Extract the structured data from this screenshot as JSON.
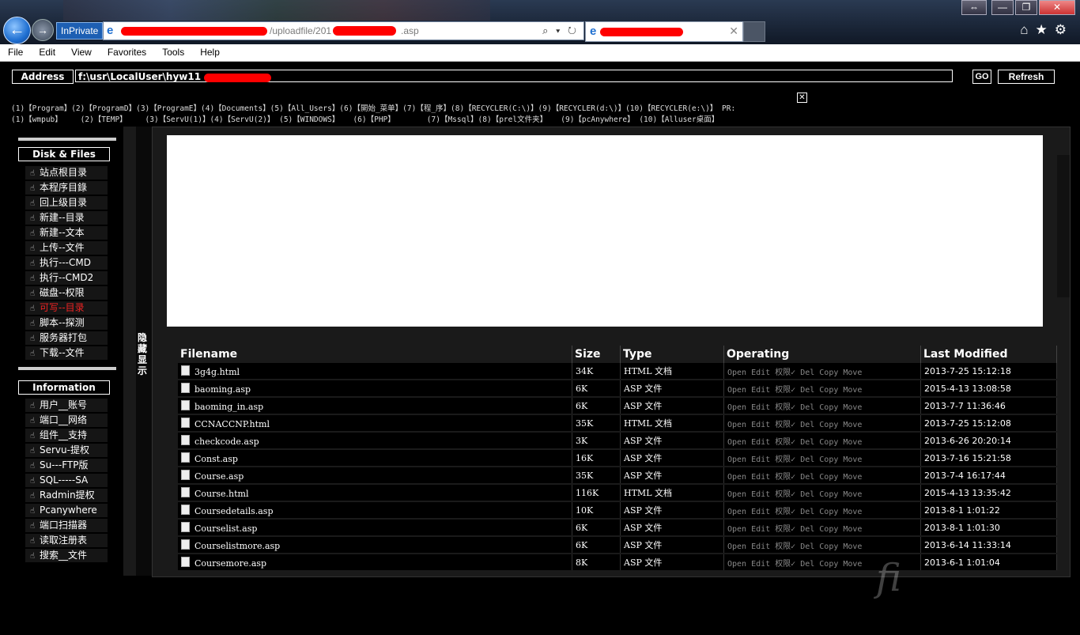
{
  "browser": {
    "inprivate_label": "InPrivate",
    "url_visible": "/uploadfile/201",
    "url_suffix": ".asp",
    "url_controls": "⌕ ▾ ↻",
    "tab_close": "✕",
    "back_icon": "←",
    "forward_icon": "→",
    "window_buttons": [
      "—",
      "❐",
      "✕"
    ],
    "restore_icon": "⇔",
    "toolbar_icons": [
      "home-icon",
      "favorites-star-icon",
      "tools-gear-icon"
    ],
    "toolbar_glyphs": "⌂★⚙"
  },
  "menu": [
    "File",
    "Edit",
    "View",
    "Favorites",
    "Tools",
    "Help"
  ],
  "address": {
    "label": "Address",
    "value": "f:\\usr\\LocalUser\\hyw11",
    "go_label": "GO",
    "refresh_label": "Refresh"
  },
  "quick_links": {
    "row1": "(1)【Program】(2)【ProgramD】(3)【ProgramE】(4)【Documents】(5)【All_Users】(6)【開始_菜单】(7)【程_序】(8)【RECYCLER(C:\\)】(9)【RECYCLER(d:\\)】(10)【RECYCLER(e:\\)】 PR:",
    "row2": "(1)【wmpub】    (2)【TEMP】    (3)【ServU(1)】(4)【ServU(2)】 (5)【WINDOWS】   (6)【PHP】       (7)【Mssql】(8)【prel文件夹】   (9)【pcAnywhere】 (10)【Alluser桌面】",
    "close_icon": "✕"
  },
  "sidebar": {
    "disk_heading": "Disk & Files",
    "disk_items": [
      "站点根目录",
      "本程序目錄",
      "回上级目录",
      "新建--目录",
      "新建--文本",
      "上传--文件",
      "执行---CMD",
      "执行--CMD2",
      "磁盘--权限",
      "可写--目录",
      "脚本--探测",
      "服务器打包",
      "下载--文件"
    ],
    "active_item": "可写--目录",
    "info_heading": "Information",
    "info_items": [
      "用户__账号",
      "端口__网络",
      "组件__支持",
      "Servu-提权",
      "Su---FTP版",
      "SQL-----SA",
      "Radmin提权",
      "Pcanywhere",
      "端口扫描器",
      "读取注册表",
      "搜索__文件"
    ],
    "item_icon": "☝",
    "toggle_label": "隐藏 显示"
  },
  "file_table": {
    "headers": [
      "Filename",
      "Size",
      "Type",
      "Operating",
      "Last Modified"
    ],
    "ops": [
      "Open",
      "Edit",
      "权限✓",
      "Del",
      "Copy",
      "Move"
    ],
    "rows": [
      {
        "name": "3g4g.html",
        "size": "34K",
        "type": "HTML 文档",
        "modified": "2013-7-25 15:12:18"
      },
      {
        "name": "baoming.asp",
        "size": "6K",
        "type": "ASP 文件",
        "modified": "2015-4-13 13:08:58"
      },
      {
        "name": "baoming_in.asp",
        "size": "6K",
        "type": "ASP 文件",
        "modified": "2013-7-7 11:36:46"
      },
      {
        "name": "CCNACCNP.html",
        "size": "35K",
        "type": "HTML 文档",
        "modified": "2013-7-25 15:12:08"
      },
      {
        "name": "checkcode.asp",
        "size": "3K",
        "type": "ASP 文件",
        "modified": "2013-6-26 20:20:14"
      },
      {
        "name": "Const.asp",
        "size": "16K",
        "type": "ASP 文件",
        "modified": "2013-7-16 15:21:58"
      },
      {
        "name": "Course.asp",
        "size": "35K",
        "type": "ASP 文件",
        "modified": "2013-7-4 16:17:44"
      },
      {
        "name": "Course.html",
        "size": "116K",
        "type": "HTML 文档",
        "modified": "2015-4-13 13:35:42"
      },
      {
        "name": "Coursedetails.asp",
        "size": "10K",
        "type": "ASP 文件",
        "modified": "2013-8-1 1:01:22"
      },
      {
        "name": "Courselist.asp",
        "size": "6K",
        "type": "ASP 文件",
        "modified": "2013-8-1 1:01:30"
      },
      {
        "name": "Courselistmore.asp",
        "size": "6K",
        "type": "ASP 文件",
        "modified": "2013-6-14 11:33:14"
      },
      {
        "name": "Coursemore.asp",
        "size": "8K",
        "type": "ASP 文件",
        "modified": "2013-6-1 1:01:04"
      }
    ]
  },
  "watermark": "fi"
}
